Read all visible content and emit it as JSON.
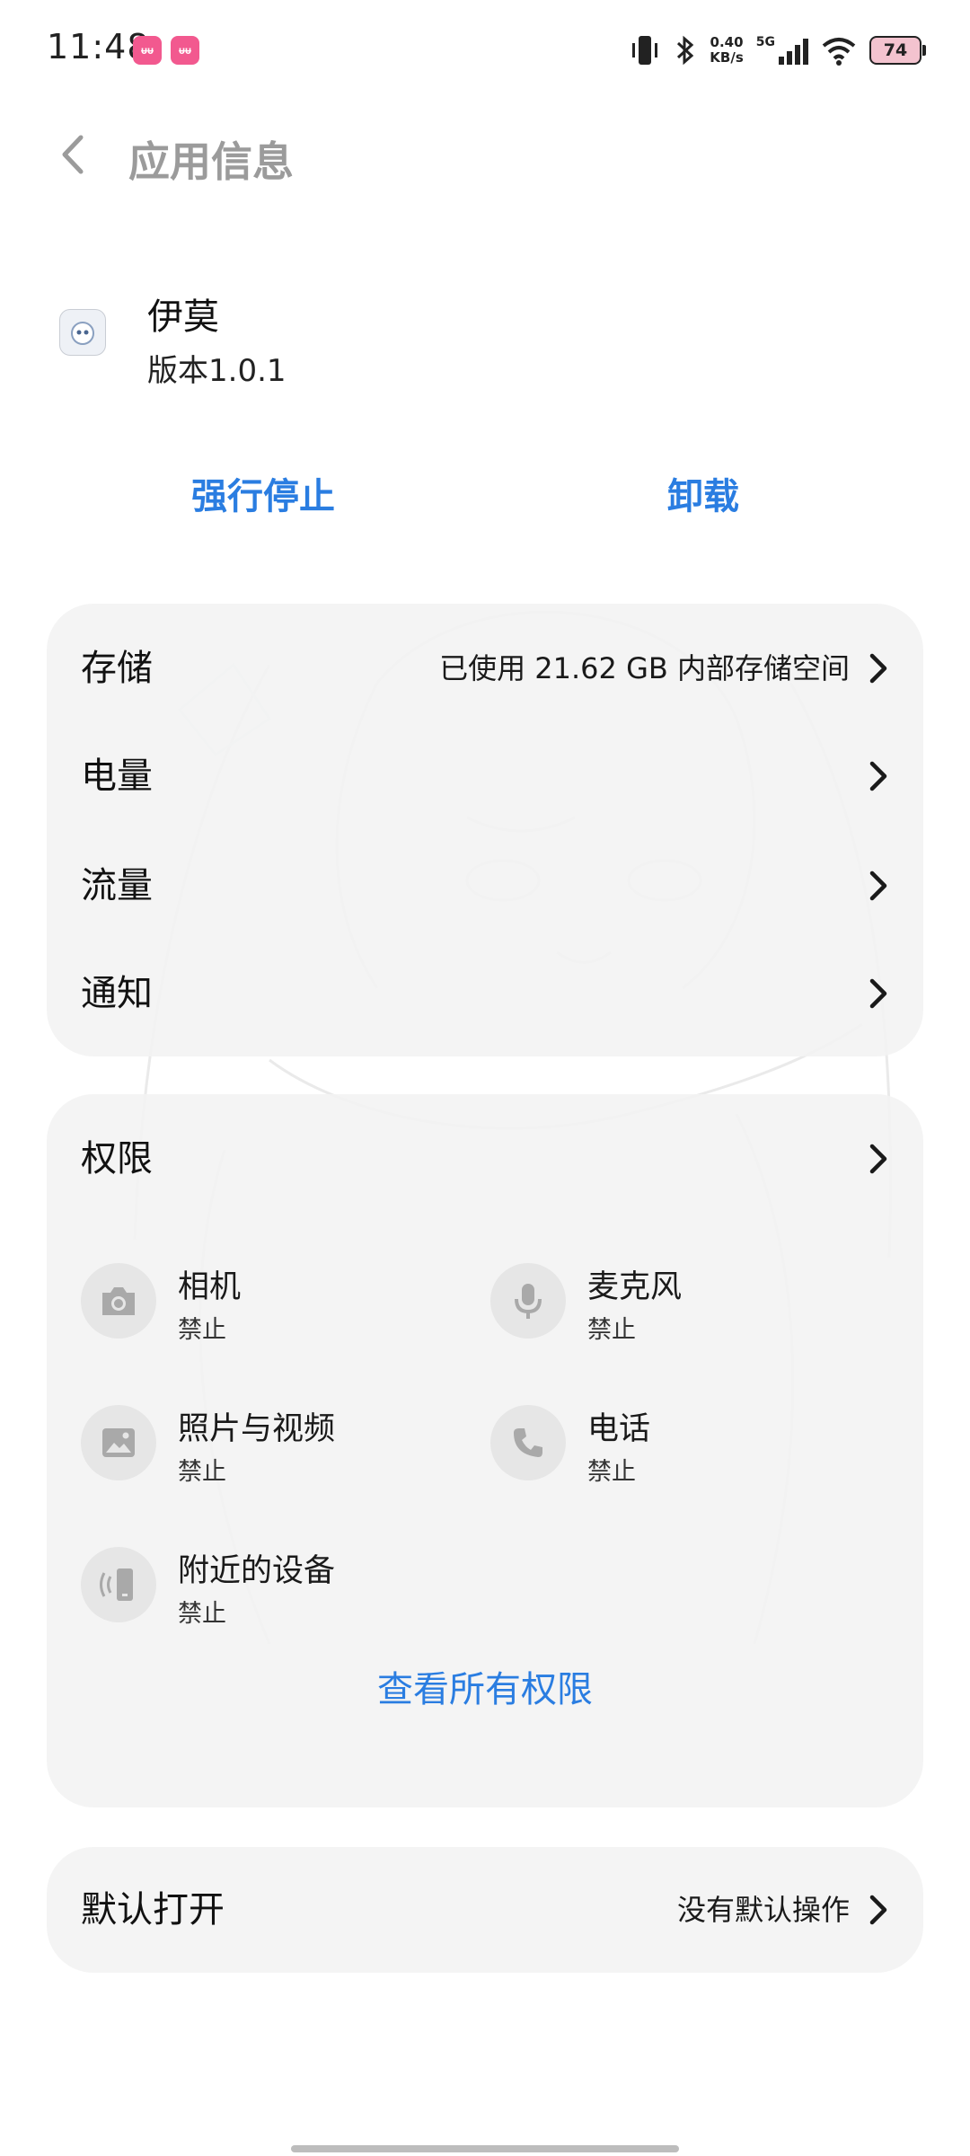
{
  "status_bar": {
    "time": "11:48",
    "notif_badge": "ᵾᵾ",
    "net_speed_value": "0.40",
    "net_speed_unit": "KB/s",
    "network_type": "5G",
    "battery": "74"
  },
  "header": {
    "title": "应用信息"
  },
  "app": {
    "name": "伊莫",
    "version": "版本1.0.1"
  },
  "actions": {
    "force_stop": "强行停止",
    "uninstall": "卸载"
  },
  "info_rows": [
    {
      "label": "存储",
      "value": "已使用 21.62 GB 内部存储空间"
    },
    {
      "label": "电量",
      "value": ""
    },
    {
      "label": "流量",
      "value": ""
    },
    {
      "label": "通知",
      "value": ""
    }
  ],
  "permissions": {
    "title": "权限",
    "items": [
      {
        "name": "相机",
        "status": "禁止",
        "icon": "camera-icon"
      },
      {
        "name": "麦克风",
        "status": "禁止",
        "icon": "microphone-icon"
      },
      {
        "name": "照片与视频",
        "status": "禁止",
        "icon": "photo-icon"
      },
      {
        "name": "电话",
        "status": "禁止",
        "icon": "phone-icon"
      },
      {
        "name": "附近的设备",
        "status": "禁止",
        "icon": "nearby-devices-icon"
      }
    ],
    "view_all": "查看所有权限"
  },
  "default_open": {
    "label": "默认打开",
    "value": "没有默认操作"
  },
  "colors": {
    "accent": "#2a7de1",
    "card_bg": "#f3f3f3",
    "title_gray": "#9b9b9b"
  }
}
